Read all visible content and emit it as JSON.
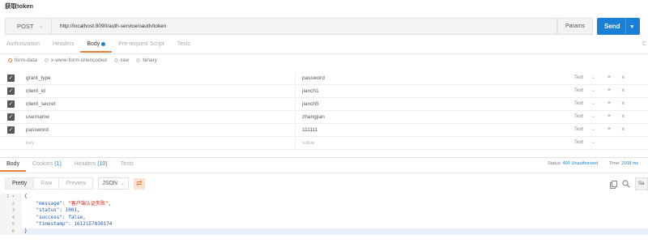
{
  "window_title": "获取token",
  "request": {
    "method": "POST",
    "url": "http://localhost:8090/auth-service/oauth/token",
    "params_label": "Params",
    "send_label": "Send"
  },
  "request_tabs": [
    "Authorization",
    "Headers",
    "Body",
    "Pre-request Script",
    "Tests"
  ],
  "active_request_tab": "Body",
  "cookies_label": "C",
  "body_modes": [
    "form-data",
    "x-www-form-urlencoded",
    "raw",
    "binary"
  ],
  "active_body_mode": "form-data",
  "form_rows": [
    {
      "key": "grant_type",
      "value": "password",
      "type": "Text"
    },
    {
      "key": "client_id",
      "value": "jianch1",
      "type": "Text"
    },
    {
      "key": "client_secret",
      "value": "jianch5",
      "type": "Text"
    },
    {
      "key": "username",
      "value": "zhangjian",
      "type": "Text"
    },
    {
      "key": "password",
      "value": "111111",
      "type": "Text"
    }
  ],
  "new_row": {
    "key_placeholder": "key",
    "value_placeholder": "value",
    "type": "Text"
  },
  "response": {
    "tabs": [
      {
        "label": "Body",
        "count": ""
      },
      {
        "label": "Cookies",
        "count": "(1)"
      },
      {
        "label": "Headers",
        "count": "(10)"
      },
      {
        "label": "Tests",
        "count": ""
      }
    ],
    "status_label": "Status:",
    "status_value": "401 Unauthorized",
    "time_label": "Time:",
    "time_value": "2168 ms",
    "formats": [
      "Pretty",
      "Raw",
      "Preview"
    ],
    "active_format": "Pretty",
    "format_select": "JSON",
    "save_label": "Sa",
    "line_numbers": [
      "1",
      "2",
      "3",
      "4",
      "5",
      "6"
    ],
    "code": {
      "open": "{",
      "message_key": "\"message\"",
      "message_val": "\"客户端认证失败\"",
      "status_key": "\"status\"",
      "status_val": "1001",
      "success_key": "\"success\"",
      "success_val": "false",
      "timestamp_key": "\"timestamp\"",
      "timestamp_val": "1612157830174",
      "close": "}"
    }
  },
  "colors": {
    "accent": "#e8803a",
    "send": "#1a7fd6",
    "status_error": "#1a7fd6"
  }
}
